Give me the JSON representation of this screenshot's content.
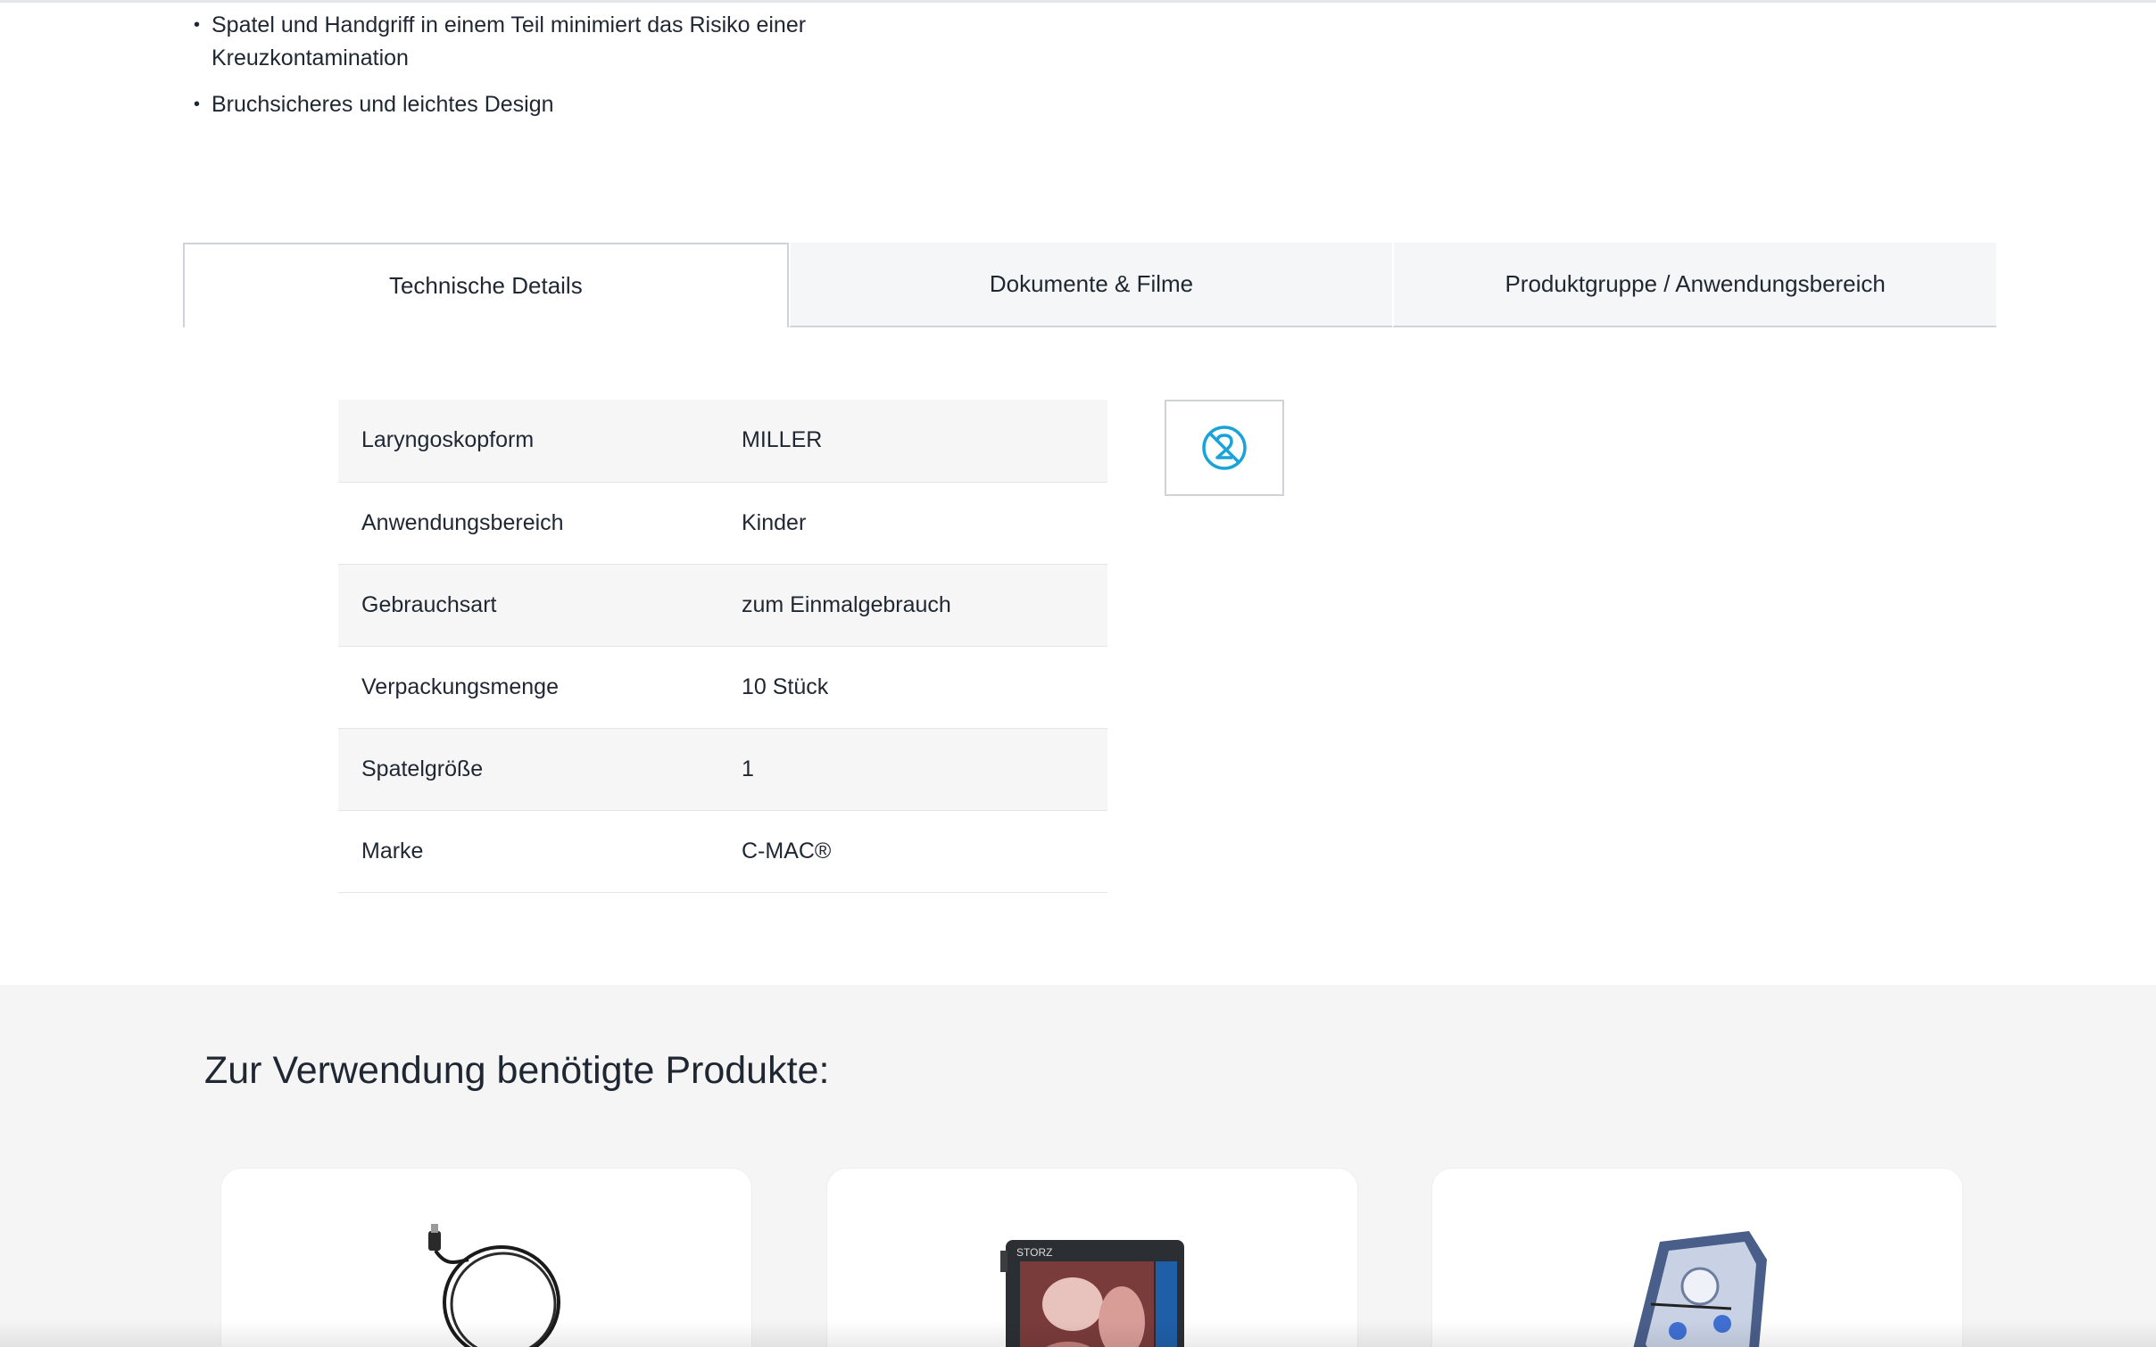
{
  "bullets": [
    "Spatel und Handgriff in einem Teil minimiert das Risiko einer Kreuzkontamination",
    "Bruchsicheres und leichtes Design"
  ],
  "tabs": [
    {
      "label": "Technische Details",
      "active": true
    },
    {
      "label": "Dokumente & Filme",
      "active": false
    },
    {
      "label": "Produktgruppe / Anwendungsbereich",
      "active": false
    }
  ],
  "specs": [
    {
      "key": "Laryngoskopform",
      "value": "MILLER"
    },
    {
      "key": "Anwendungsbereich",
      "value": "Kinder"
    },
    {
      "key": "Gebrauchsart",
      "value": "zum Einmalgebrauch"
    },
    {
      "key": "Verpackungsmenge",
      "value": "10 Stück"
    },
    {
      "key": "Spatelgröße",
      "value": "1"
    },
    {
      "key": "Marke",
      "value": "C-MAC®"
    }
  ],
  "single_use_icon": "do-not-reuse-icon",
  "related": {
    "title": "Zur Verwendung benötigte Produkte:",
    "cards": [
      {
        "image": "cable-icon"
      },
      {
        "image": "monitor-icon"
      },
      {
        "image": "case-icon"
      }
    ]
  },
  "colors": {
    "accent": "#1aa3d9",
    "text": "#1f2733",
    "tab_bg": "#f5f6f7",
    "section_bg": "#f5f5f5"
  }
}
